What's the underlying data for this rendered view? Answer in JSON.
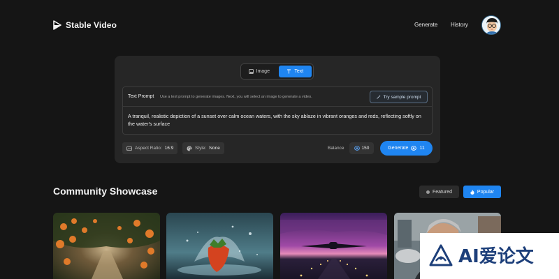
{
  "header": {
    "brand": "Stable Video",
    "nav": {
      "generate": "Generate",
      "history": "History"
    }
  },
  "prompt_card": {
    "tabs": [
      {
        "label": "Image",
        "icon": "image-icon",
        "active": false
      },
      {
        "label": "Text",
        "icon": "text-icon",
        "active": true
      }
    ],
    "prompt_label": "Text Prompt",
    "prompt_hint": "Use a text prompt to generate images. Next, you will select an image to generate a video.",
    "sample_button": "Try sample prompt",
    "prompt_value": "A tranquil, realistic depiction of a sunset over calm ocean waters, with the sky ablaze in vibrant oranges and reds, reflecting softly on the water's surface",
    "aspect_ratio": {
      "label": "Aspect Ratio:",
      "value": "16:9"
    },
    "style": {
      "label": "Style:",
      "value": "None"
    },
    "balance": {
      "label": "Balance",
      "value": "150"
    },
    "generate": {
      "label": "Generate",
      "cost": "11"
    }
  },
  "community": {
    "title": "Community Showcase",
    "filters": [
      {
        "label": "Featured",
        "active": false
      },
      {
        "label": "Popular",
        "active": true
      }
    ]
  },
  "colors": {
    "accent": "#1f85f1",
    "background": "#151515",
    "card": "#262626"
  },
  "watermark": {
    "text": "AI爱论文"
  }
}
